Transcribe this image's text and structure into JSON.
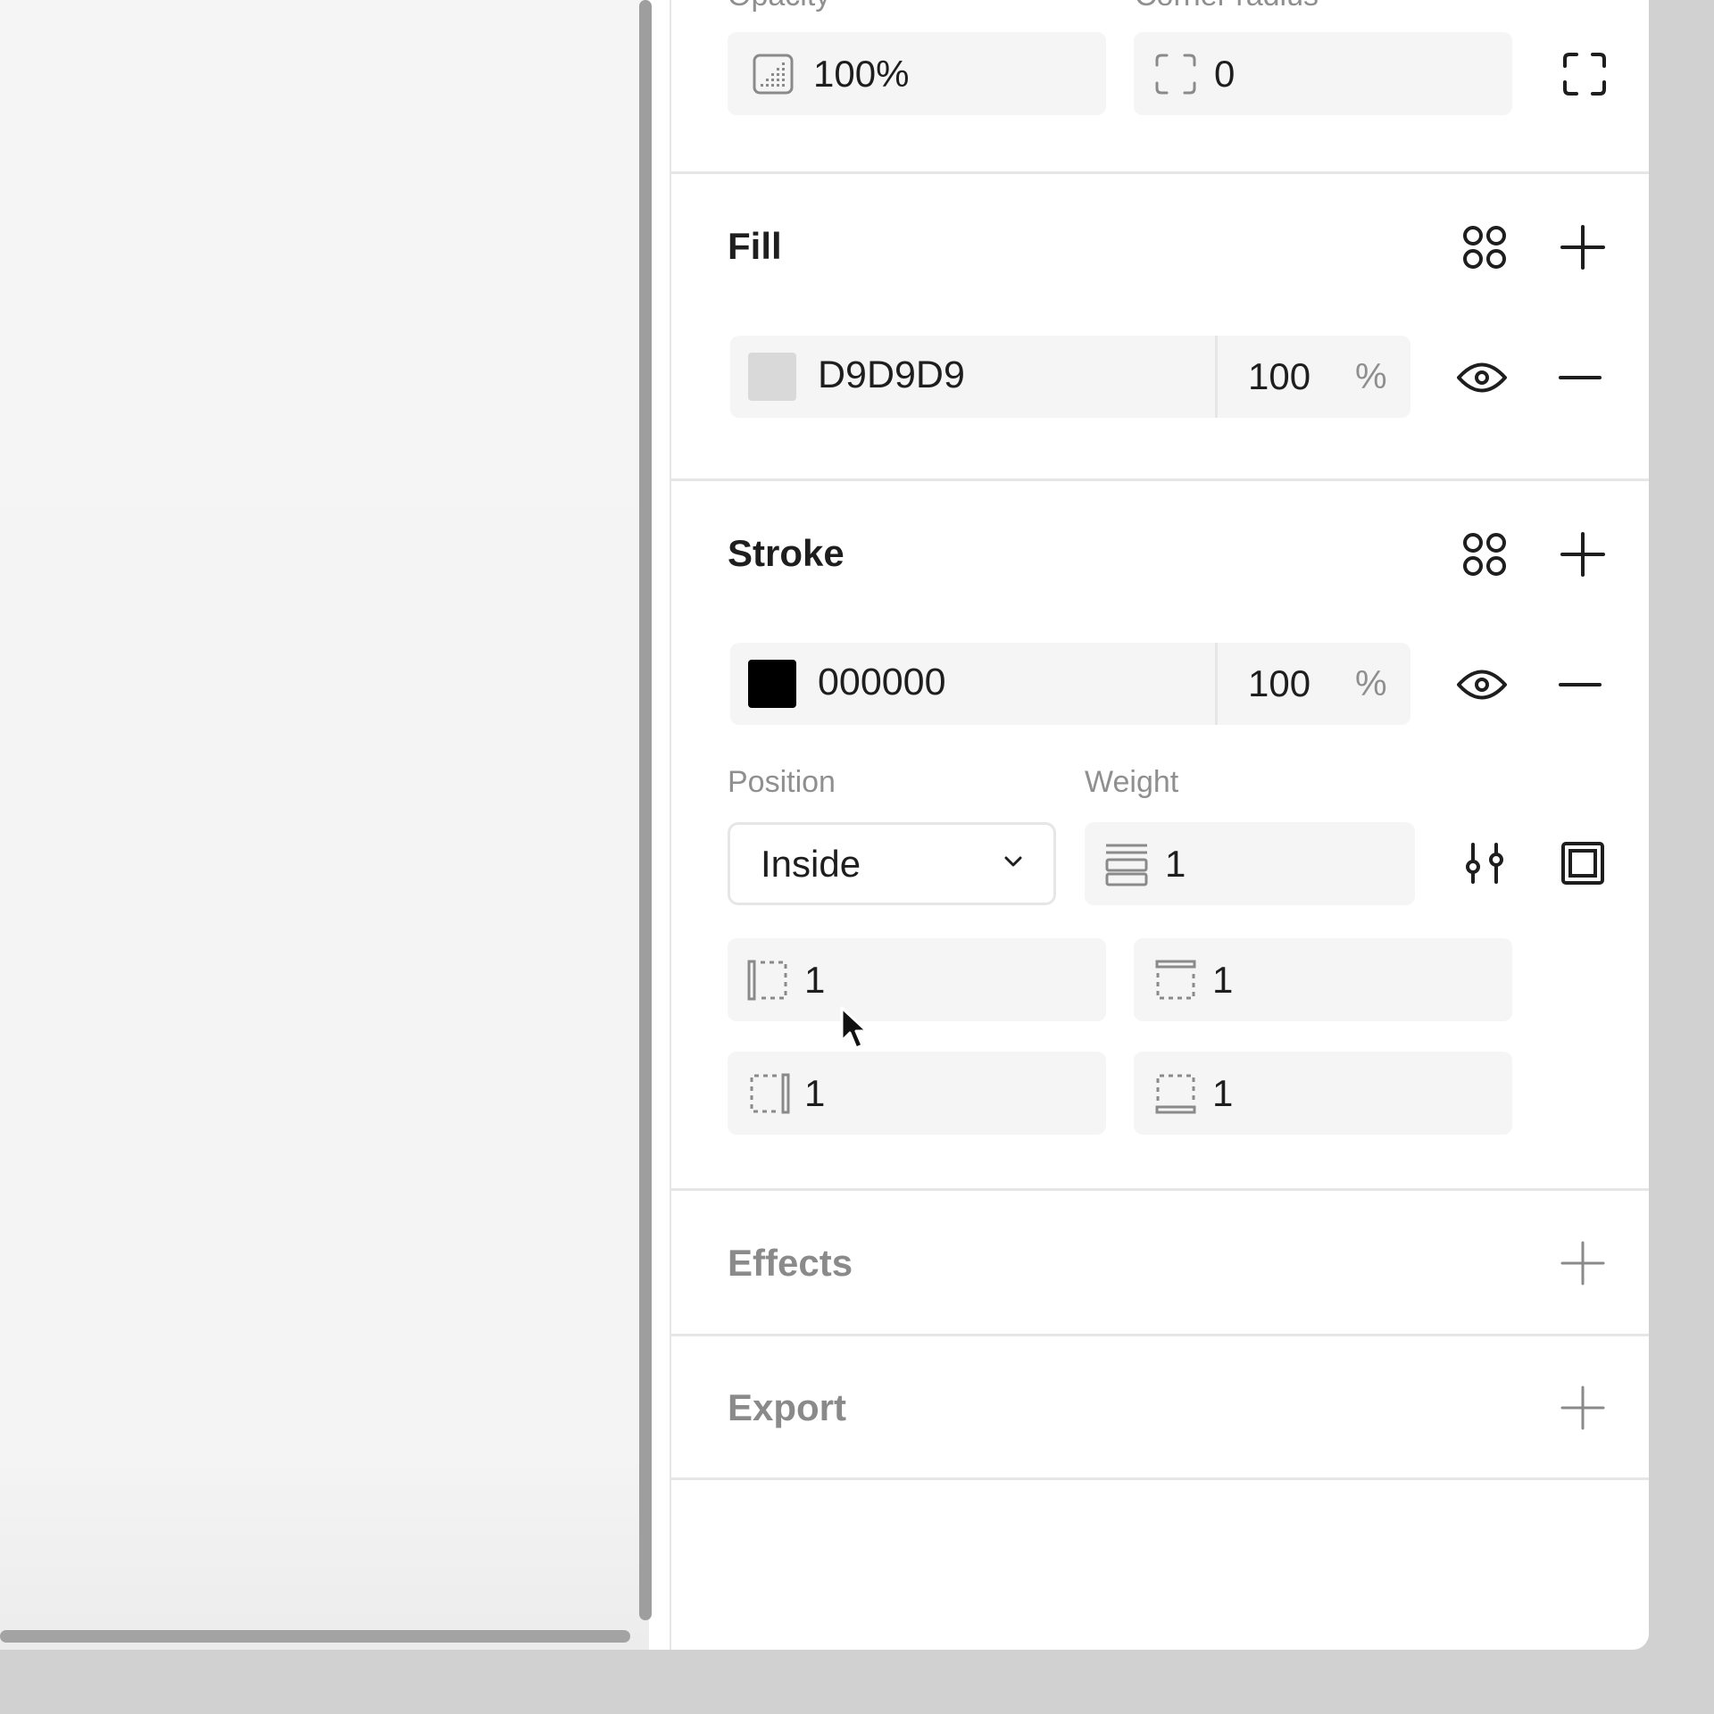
{
  "top_row": {
    "opacity_label": "Opacity",
    "opacity_value": "100%",
    "corner_radius_label": "Corner radius",
    "corner_radius_value": "0"
  },
  "fill": {
    "title": "Fill",
    "color_hex": "D9D9D9",
    "swatch_color": "#D9D9D9",
    "opacity": "100",
    "percent_sign": "%"
  },
  "stroke": {
    "title": "Stroke",
    "color_hex": "000000",
    "swatch_color": "#000000",
    "opacity": "100",
    "percent_sign": "%",
    "position_label": "Position",
    "position_value": "Inside",
    "weight_label": "Weight",
    "weight_value": "1",
    "sides": {
      "left": "1",
      "top": "1",
      "right": "1",
      "bottom": "1"
    }
  },
  "effects": {
    "title": "Effects"
  },
  "export": {
    "title": "Export"
  },
  "icons": {
    "opacity": "opacity-icon",
    "corner_radius": "corner-radius-icon",
    "independent_corners": "independent-corners-icon",
    "style_grid": "style-grid-icon",
    "add": "plus-icon",
    "visibility": "eye-icon",
    "remove": "minus-icon",
    "weight": "stroke-weight-icon",
    "stroke_settings": "sliders-icon",
    "individual_strokes": "individual-strokes-icon",
    "cursor": "mouse-cursor-icon"
  }
}
